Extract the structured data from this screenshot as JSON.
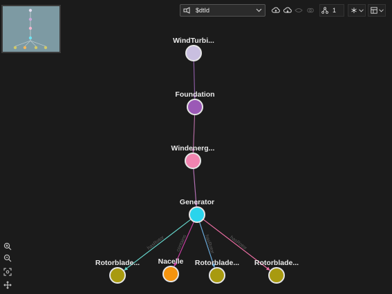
{
  "toolbar": {
    "query_text": "$dtId",
    "depth_value": "1"
  },
  "graph": {
    "nodes": [
      {
        "id": "windturbine",
        "label": "WindTurbi...",
        "color": "#c9bfe0"
      },
      {
        "id": "foundation",
        "label": "Foundation",
        "color": "#9b59b6"
      },
      {
        "id": "windenergy",
        "label": "Windenerg...",
        "color": "#f184b0"
      },
      {
        "id": "generator",
        "label": "Generator",
        "color": "#2ad4ec"
      },
      {
        "id": "rotorblade1",
        "label": "Rotorblade...",
        "color": "#a89a10"
      },
      {
        "id": "nacelle",
        "label": "Nacelle",
        "color": "#f5940f"
      },
      {
        "id": "rotorblade2",
        "label": "Rotorblade...",
        "color": "#a89a10"
      },
      {
        "id": "rotorblade3",
        "label": "Rotorblade...",
        "color": "#a89a10"
      }
    ],
    "edges": [
      {
        "from": "windturbine",
        "to": "foundation",
        "label": "",
        "color": "#8a5aa0"
      },
      {
        "from": "foundation",
        "to": "windenergy",
        "label": "",
        "color": "#b06aa0"
      },
      {
        "from": "windenergy",
        "to": "generator",
        "label": "",
        "color": "#b070b0"
      },
      {
        "from": "generator",
        "to": "rotorblade1",
        "label": "hasRotor",
        "color": "#66d6cc"
      },
      {
        "from": "generator",
        "to": "nacelle",
        "label": "contains",
        "color": "#c63ea0"
      },
      {
        "from": "generator",
        "to": "rotorblade2",
        "label": "hasRotor",
        "color": "#6aa8d8"
      },
      {
        "from": "generator",
        "to": "rotorblade3",
        "label": "hasRotor",
        "color": "#ee6fa4"
      }
    ]
  }
}
